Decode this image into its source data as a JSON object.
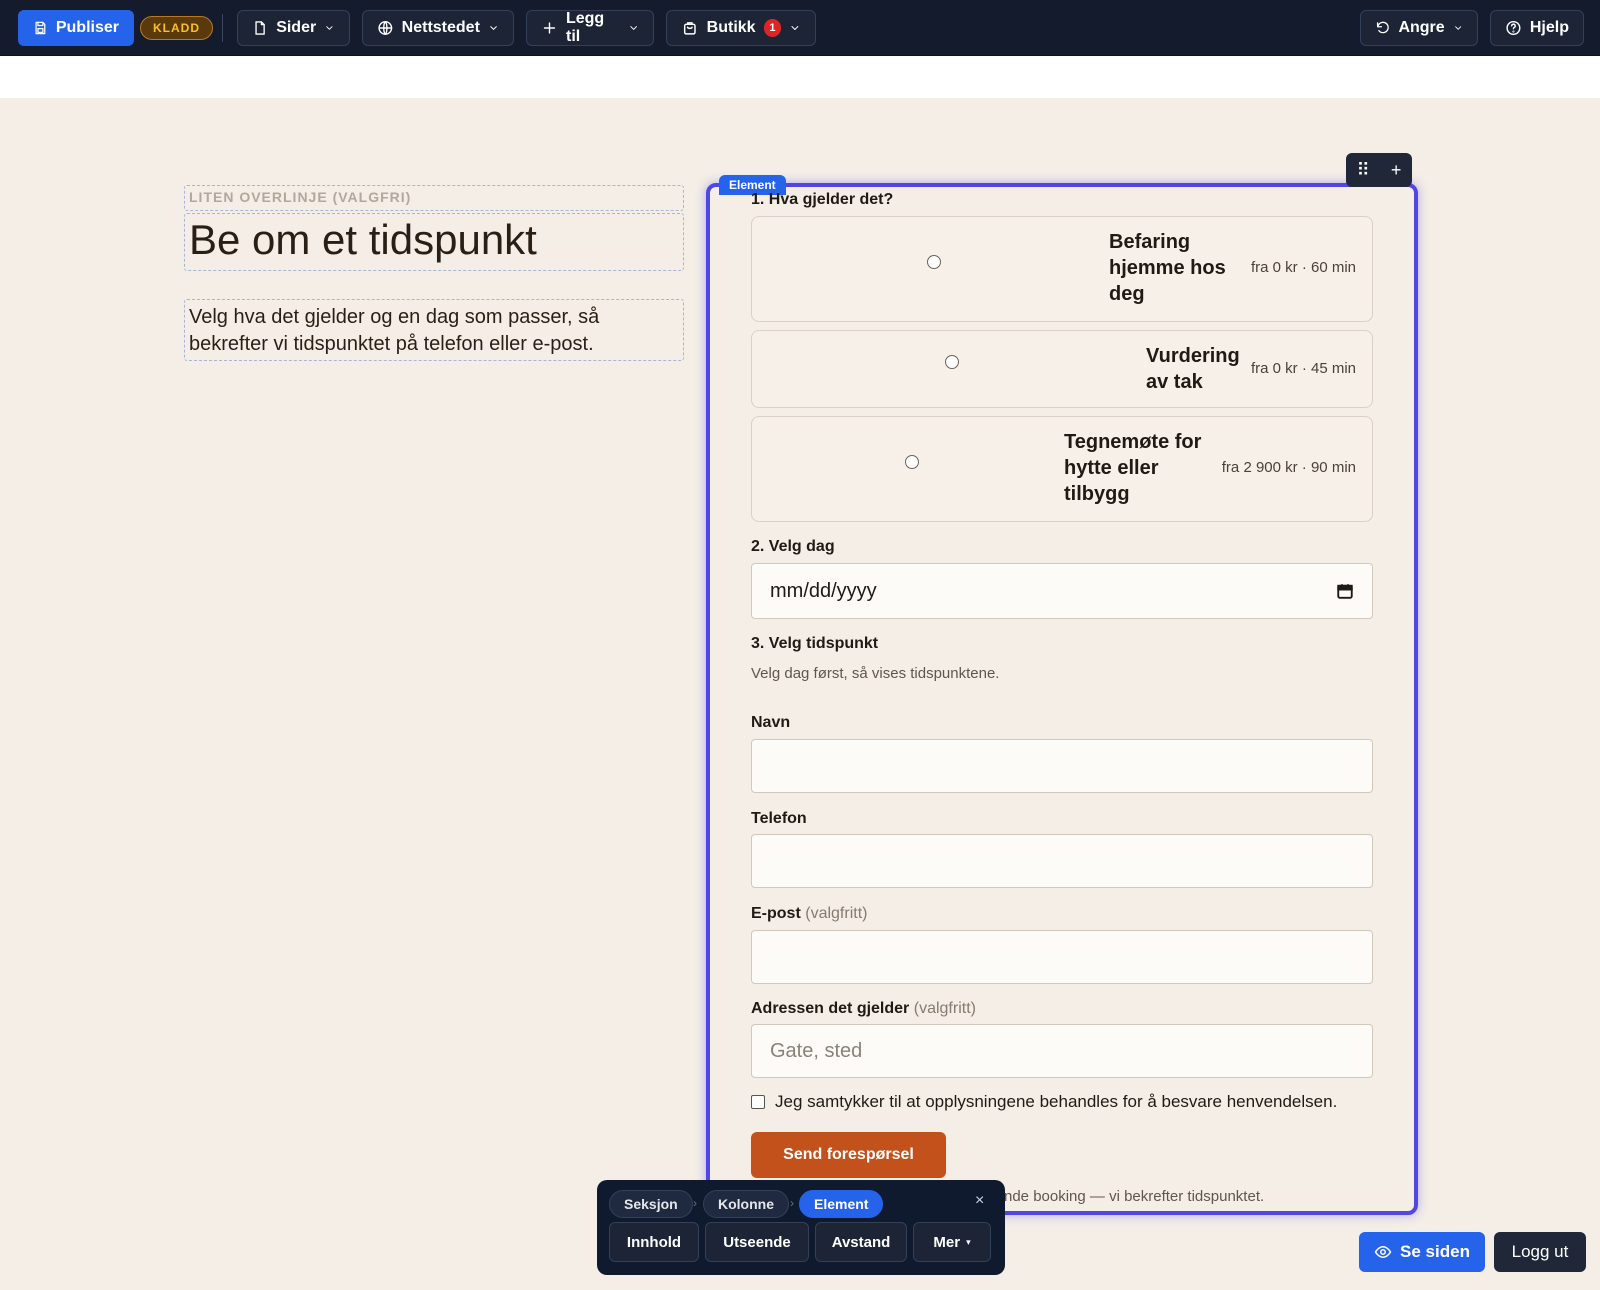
{
  "toolbar": {
    "publish_label": "Publiser",
    "draft_badge": "KLADD",
    "pages_label": "Sider",
    "site_label": "Nettstedet",
    "add_label": "Legg til",
    "shop_label": "Butikk",
    "shop_count": "1",
    "undo_label": "Angre",
    "help_label": "Hjelp"
  },
  "intro": {
    "overline": "LITEN OVERLINJE (VALGFRI)",
    "title": "Be om et tidspunkt",
    "lead": "Velg hva det gjelder og en dag som passer, så bekrefter vi tidspunktet på telefon eller e-post."
  },
  "element": {
    "tag": "Element"
  },
  "form": {
    "q1": "1. Hva gjelder det?",
    "options": [
      {
        "title": "Befaring hjemme hos deg",
        "meta": "fra 0 kr · 60 min"
      },
      {
        "title": "Vurdering av tak",
        "meta": "fra 0 kr · 45 min"
      },
      {
        "title": "Tegnemøte for hytte eller tilbygg",
        "meta": "fra 2 900 kr · 90 min"
      }
    ],
    "q2": "2. Velg dag",
    "date_placeholder": "mm/dd/yyyy",
    "q3": "3. Velg tidspunkt",
    "q3_hint": "Velg dag først, så vises tidspunktene.",
    "name_label": "Navn",
    "phone_label": "Telefon",
    "email_label": "E-post",
    "optional": "(valgfritt)",
    "address_label": "Adressen det gjelder",
    "address_placeholder": "Gate, sted",
    "consent": "Jeg samtykker til at opplysningene behandles for å besvare henvendelsen.",
    "submit": "Send forespørsel",
    "footnote": "nde booking — vi bekrefter tidspunktet."
  },
  "panel": {
    "crumbs": [
      "Seksjon",
      "Kolonne",
      "Element"
    ],
    "close": "×",
    "tabs": [
      "Innhold",
      "Utseende",
      "Avstand",
      "Mer"
    ],
    "more_caret": "▾"
  },
  "footer": {
    "see_site": "Se siden",
    "logout": "Logg ut"
  },
  "colors": {
    "accent": "#2563eb",
    "selection": "#4f46e5",
    "submit": "#c2511c",
    "background": "#f4eee6"
  }
}
